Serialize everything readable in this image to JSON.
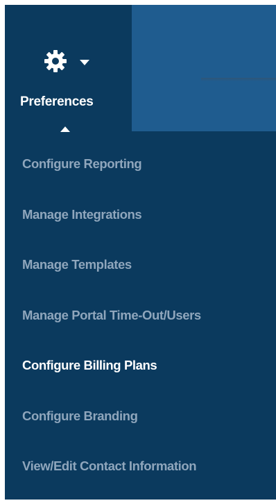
{
  "preferences": {
    "label": "Preferences",
    "icon": "gear-icon",
    "dropdown_icon": "caret-down-icon",
    "open_indicator_icon": "caret-up-icon"
  },
  "menu": {
    "items": [
      {
        "label": "Configure Reporting",
        "active": false
      },
      {
        "label": "Manage Integrations",
        "active": false
      },
      {
        "label": "Manage Templates",
        "active": false
      },
      {
        "label": "Manage Portal Time-Out/Users",
        "active": false
      },
      {
        "label": "Configure Billing Plans",
        "active": true
      },
      {
        "label": "Configure Branding",
        "active": false
      },
      {
        "label": "View/Edit Contact Information",
        "active": false
      }
    ]
  },
  "colors": {
    "panel_bg": "#0b3a5e",
    "header_bg": "#1f5c8f",
    "item_text": "#8fa6bc",
    "active_text": "#ffffff"
  }
}
